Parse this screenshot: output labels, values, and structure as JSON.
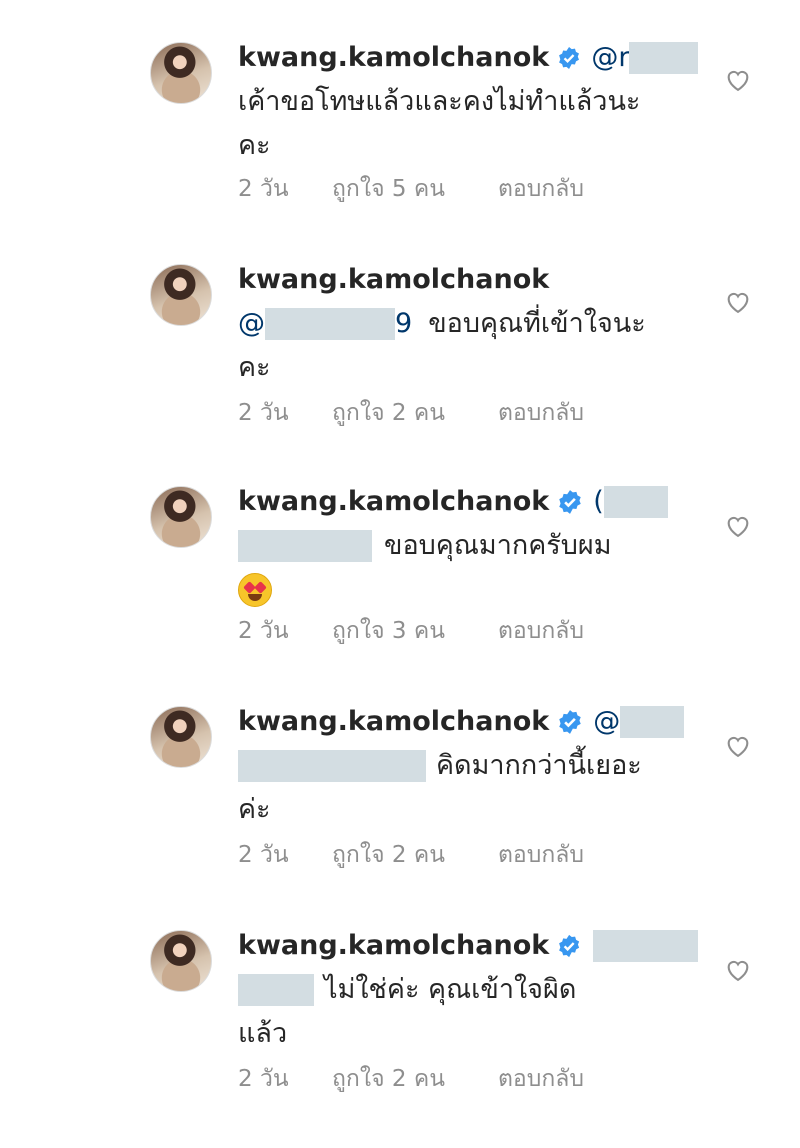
{
  "comments": [
    {
      "username": "kwang.kamolchanok",
      "mention": "@r",
      "lines": [
        "เค้าขอโทษแล้วและคงไม่ทำแล้วนะ",
        "คะ"
      ],
      "time": "2 วัน",
      "likes": "ถูกใจ 5 คน",
      "reply": "ตอบกลับ"
    },
    {
      "username": "kwang.kamolchanok",
      "mention": "@",
      "mention_suffix": "9",
      "lines": [
        "ขอบคุณที่เข้าใจนะ",
        "คะ"
      ],
      "time": "2 วัน",
      "likes": "ถูกใจ 2 คน",
      "reply": "ตอบกลับ"
    },
    {
      "username": "kwang.kamolchanok",
      "mention": "(",
      "lines": [
        "ขอบคุณมากครับผม",
        ""
      ],
      "time": "2 วัน",
      "likes": "ถูกใจ 3 คน",
      "reply": "ตอบกลับ"
    },
    {
      "username": "kwang.kamolchanok",
      "mention": "@",
      "lines": [
        "คิดมากกว่านี้เยอะ",
        "ค่ะ"
      ],
      "time": "2 วัน",
      "likes": "ถูกใจ 2 คน",
      "reply": "ตอบกลับ"
    },
    {
      "username": "kwang.kamolchanok",
      "mention": "",
      "lines": [
        "ไม่ใช่ค่ะ คุณเข้าใจผิด",
        "แล้ว"
      ],
      "time": "2 วัน",
      "likes": "ถูกใจ 2 คน",
      "reply": "ตอบกลับ"
    }
  ],
  "colors": {
    "verified": "#3897f0",
    "meta": "#8e8e8e",
    "text": "#262626",
    "redaction": "#d3dde2"
  },
  "icons": {
    "verified": "verified-badge-icon",
    "like": "heart-outline-icon",
    "emoji": "heart-eyes-emoji"
  }
}
